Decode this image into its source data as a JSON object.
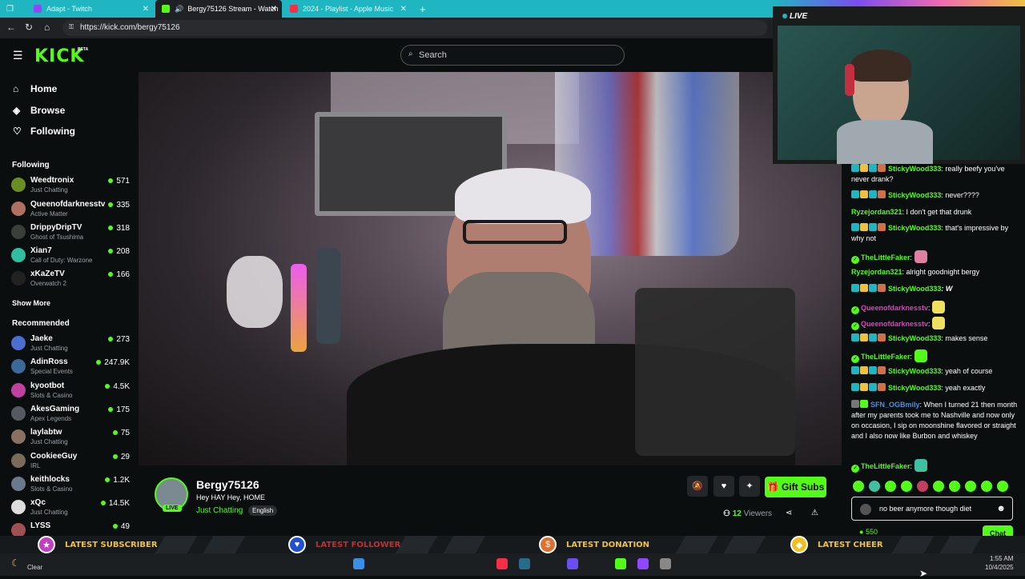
{
  "browser": {
    "tabs": [
      {
        "title": "Adapt - Twitch",
        "icon_color": "#9146ff"
      },
      {
        "title": "Bergy75126 Stream - Watch",
        "icon_color": "#53fc18"
      },
      {
        "title": "2024 - Playlist - Apple Music",
        "icon_color": "#fa2d48"
      }
    ],
    "new_tab": "+",
    "url": "https://kick.com/bergy75126"
  },
  "header": {
    "logo": "KICK",
    "logo_badge": "BETA",
    "search_placeholder": "Search"
  },
  "sidebar": {
    "nav": [
      {
        "label": "Home",
        "icon": "home-icon"
      },
      {
        "label": "Browse",
        "icon": "compass-icon"
      },
      {
        "label": "Following",
        "icon": "heart-icon"
      }
    ],
    "following_heading": "Following",
    "following": [
      {
        "name": "Weedtronix",
        "category": "Just Chatting",
        "viewers": "571",
        "color": "#6b8e23"
      },
      {
        "name": "Queenofdarknesstv",
        "category": "Active Matter",
        "viewers": "335",
        "color": "#b07060"
      },
      {
        "name": "DrippyDripTV",
        "category": "Ghost of Tsushima",
        "viewers": "318",
        "color": "#3a3f3a"
      },
      {
        "name": "Xian7",
        "category": "Call of Duty: Warzone",
        "viewers": "208",
        "color": "#2fbfa0"
      },
      {
        "name": "xKaZeTV",
        "category": "Overwatch 2",
        "viewers": "166",
        "color": "#222222"
      }
    ],
    "show_more": "Show More",
    "recommended_heading": "Recommended",
    "recommended": [
      {
        "name": "Jaeke",
        "category": "Just Chatting",
        "viewers": "273",
        "color": "#4a6fd0"
      },
      {
        "name": "AdinRoss",
        "category": "Special Events",
        "viewers": "247.9K",
        "color": "#3a6a9a"
      },
      {
        "name": "kyootbot",
        "category": "Slots & Casino",
        "viewers": "4.5K",
        "color": "#c040a0"
      },
      {
        "name": "AkesGaming",
        "category": "Apex Legends",
        "viewers": "175",
        "color": "#555a60"
      },
      {
        "name": "laylabtw",
        "category": "Just Chatting",
        "viewers": "75",
        "color": "#8a7060"
      },
      {
        "name": "CookieeGuy",
        "category": "IRL",
        "viewers": "29",
        "color": "#7a6a5a"
      },
      {
        "name": "keithlocks",
        "category": "Slots & Casino",
        "viewers": "1.2K",
        "color": "#6a7a8a"
      },
      {
        "name": "xQc",
        "category": "Just Chatting",
        "viewers": "14.5K",
        "color": "#dddddd"
      },
      {
        "name": "LYSS",
        "category": "",
        "viewers": "49",
        "color": "#a05050"
      }
    ]
  },
  "stream": {
    "streamer": "Bergy75126",
    "title": "Hey HAY Hey, HOME",
    "category": "Just Chatting",
    "language": "English",
    "live_badge": "LIVE",
    "gift_subs": "Gift Subs",
    "viewer_count": "12",
    "viewer_label": "Viewers"
  },
  "overlay": {
    "live_label": "LIVE"
  },
  "chat": {
    "messages": [
      {
        "user": "StickyWood333",
        "color": "#53fc18",
        "text": ": really beefy you've never drank?",
        "badges": [
          "#1fb6c1",
          "#f0c040",
          "#1fb6c1",
          "#d0704a"
        ]
      },
      {
        "user": "StickyWood333",
        "color": "#53fc18",
        "text": ": never????",
        "badges": [
          "#1fb6c1",
          "#f0c040",
          "#1fb6c1",
          "#d0704a"
        ]
      },
      {
        "user": "Ryzejordan321",
        "color": "#53fc18",
        "text": ": I don't get that drunk",
        "badges": []
      },
      {
        "user": "StickyWood333",
        "color": "#53fc18",
        "text": ": that's impressive by why not",
        "badges": [
          "#1fb6c1",
          "#f0c040",
          "#1fb6c1",
          "#d0704a"
        ]
      },
      {
        "user": "TheLittleFaker",
        "color": "#53fc18",
        "text": ":",
        "verified": true,
        "emote": "#e080a0"
      },
      {
        "user": "Ryzejordan321",
        "color": "#53fc18",
        "text": ": alright goodnight bergy",
        "badges": []
      },
      {
        "user": "StickyWood333",
        "color": "#53fc18",
        "text": ": W",
        "badges": [
          "#1fb6c1",
          "#f0c040",
          "#1fb6c1",
          "#d0704a"
        ]
      },
      {
        "user": "Queenofdarknesstv",
        "color": "#e040c0",
        "text": ":",
        "verified": true,
        "emote": "#f0e060"
      },
      {
        "user": "Queenofdarknesstv",
        "color": "#e040c0",
        "text": ":",
        "verified": true,
        "emote": "#f0e060"
      },
      {
        "user": "StickyWood333",
        "color": "#53fc18",
        "text": ": makes sense",
        "badges": [
          "#1fb6c1",
          "#f0c040",
          "#1fb6c1",
          "#d0704a"
        ]
      },
      {
        "user": "TheLittleFaker",
        "color": "#53fc18",
        "text": ":",
        "verified": true,
        "emote": "#53fc18"
      },
      {
        "user": "StickyWood333",
        "color": "#53fc18",
        "text": ": yeah of course",
        "badges": [
          "#1fb6c1",
          "#f0c040",
          "#1fb6c1",
          "#d0704a"
        ]
      },
      {
        "user": "StickyWood333",
        "color": "#53fc18",
        "text": ": yeah exactly",
        "badges": [
          "#1fb6c1",
          "#f0c040",
          "#1fb6c1",
          "#d0704a"
        ]
      },
      {
        "user": "SFN_OGBmily",
        "color": "#4a90e2",
        "text": ": When I turned 21 then month after my parents took me to Nashville and now only on occasion, I sip on moonshine flavored or straight and I also now like Burbon and whiskey",
        "badges": [
          "#777777",
          "#53fc18"
        ]
      },
      {
        "user": "TheLittleFaker",
        "color": "#53fc18",
        "text": ":",
        "verified": true,
        "emote": "#40c0a0"
      }
    ],
    "input_value": "no beer anymore though diet",
    "points": "550",
    "send_label": "Chat"
  },
  "alerts": [
    {
      "label": "LATEST SUBSCRIBER",
      "icon": "star-icon",
      "icon_glyph": "★",
      "icon_bg": "#c040c0"
    },
    {
      "label": "LATEST FOLLOWER",
      "icon": "heart-icon",
      "icon_glyph": "♥",
      "icon_bg": "#2050d0"
    },
    {
      "label": "LATEST DONATION",
      "icon": "dollar-icon",
      "icon_glyph": "$",
      "icon_bg": "#e07030"
    },
    {
      "label": "LATEST CHEER",
      "icon": "diamond-icon",
      "icon_glyph": "◆",
      "icon_bg": "#f0c020"
    }
  ],
  "taskbar": {
    "weather": "Clear",
    "time": "1:55 AM",
    "date": "10/4/2025"
  }
}
